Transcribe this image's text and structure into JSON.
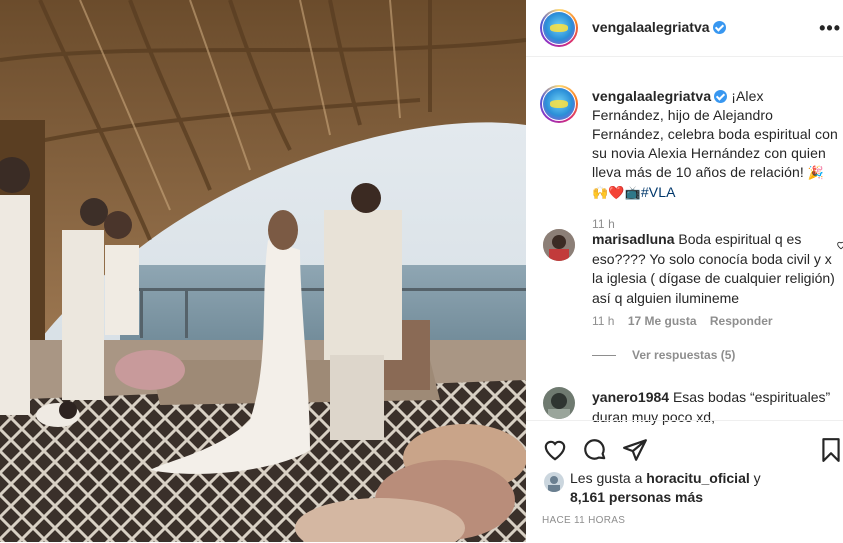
{
  "post": {
    "author": "vengalaalegriatva",
    "caption_text": "¡Alex Fernández, hijo de Alejandro Fernández, celebra boda espiritual con su novia Alexia Hernández con quien lleva más de 10 años de relación! ",
    "caption_emoji": "🎉🙌❤️📺",
    "caption_hashtag": "#VLA",
    "caption_time": "11 h",
    "more_label": "•••"
  },
  "comments": [
    {
      "username": "marisadluna",
      "text": "Boda espiritual q es eso???? Yo solo conocía boda civil y x la iglesia ( dígase de cualquier religión) así q alguien ilumineme",
      "time": "11 h",
      "likes": "17 Me gusta",
      "reply_label": "Responder",
      "view_replies": "Ver respuestas (5)"
    },
    {
      "username": "yanero1984",
      "text": "Esas bodas “espirituales” duran muy poco xd,"
    }
  ],
  "footer": {
    "liked_prefix": "Les gusta a ",
    "liked_user": "horacitu_oficial",
    "liked_mid": " y",
    "liked_count": "8,161 personas más",
    "time_ago": "Hace 11 horas"
  },
  "colors": {
    "verified": "#3897f0",
    "muted": "#8e8e8e",
    "text": "#262626",
    "link": "#00376b"
  },
  "icons": [
    "verified-badge-icon",
    "more-options-icon",
    "heart-icon",
    "comment-icon",
    "share-icon",
    "bookmark-icon"
  ]
}
